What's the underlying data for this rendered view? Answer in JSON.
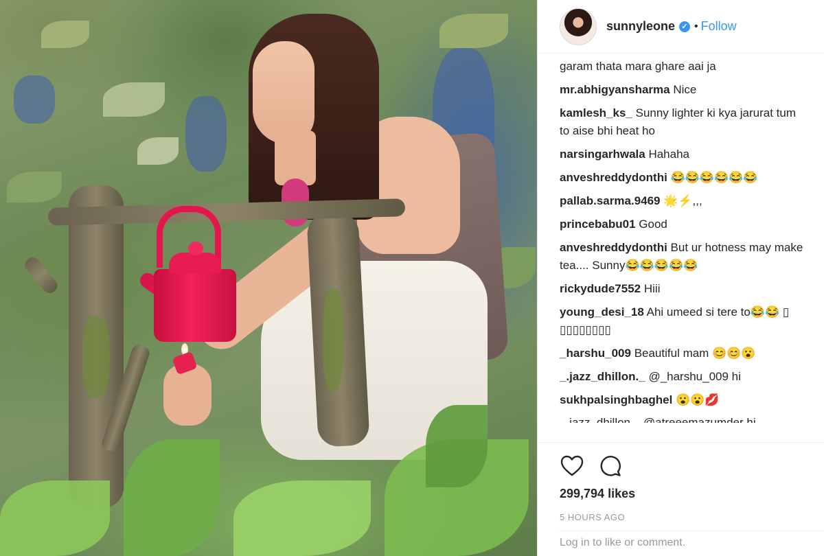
{
  "post": {
    "username": "sunnyleone",
    "separator": "•",
    "follow_label": "Follow",
    "verified_icon": "verified-badge-icon",
    "comments_cut_top": "garam thata mara ghare aai ja",
    "comments": [
      {
        "user": "mr.abhigyansharma",
        "text": "Nice"
      },
      {
        "user": "kamlesh_ks_",
        "text": "Sunny lighter ki kya jarurat tum to aise bhi heat ho"
      },
      {
        "user": "narsingarhwala",
        "text": "Hahaha"
      },
      {
        "user": "anveshreddydonthi",
        "text": "😂😂😂😂😂😂"
      },
      {
        "user": "pallab.sarma.9469",
        "text": "🌟⚡,,,"
      },
      {
        "user": "princebabu01",
        "text": "Good"
      },
      {
        "user": "anveshreddydonthi",
        "text": "But ur hotness may make tea.... Sunny😂😂😂😂😂"
      },
      {
        "user": "rickydude7552",
        "text": "Hiii"
      },
      {
        "user": "young_desi_18",
        "text": "Ahi umeed si tere to😂😂 ▯ ▯▯▯▯▯▯▯▯"
      },
      {
        "user": "_harshu_009",
        "text": "Beautiful mam 😊😊😮"
      },
      {
        "user": "_.jazz_dhillon._",
        "text": "@_harshu_009 hi"
      },
      {
        "user": "sukhpalsinghbaghel",
        "text": "😮😮💋"
      }
    ],
    "comments_cut_bottom": "_.jazz_dhillon._ @atreeemazumder hi",
    "like_icon": "heart-icon",
    "comment_icon": "comment-bubble-icon",
    "likes": "299,794 likes",
    "time": "5 HOURS AGO",
    "add_comment_placeholder": "Log in to like or comment."
  },
  "colors": {
    "accent": "#3897f0",
    "text": "#262626",
    "muted": "#999999",
    "kettle": "#e81c52"
  }
}
